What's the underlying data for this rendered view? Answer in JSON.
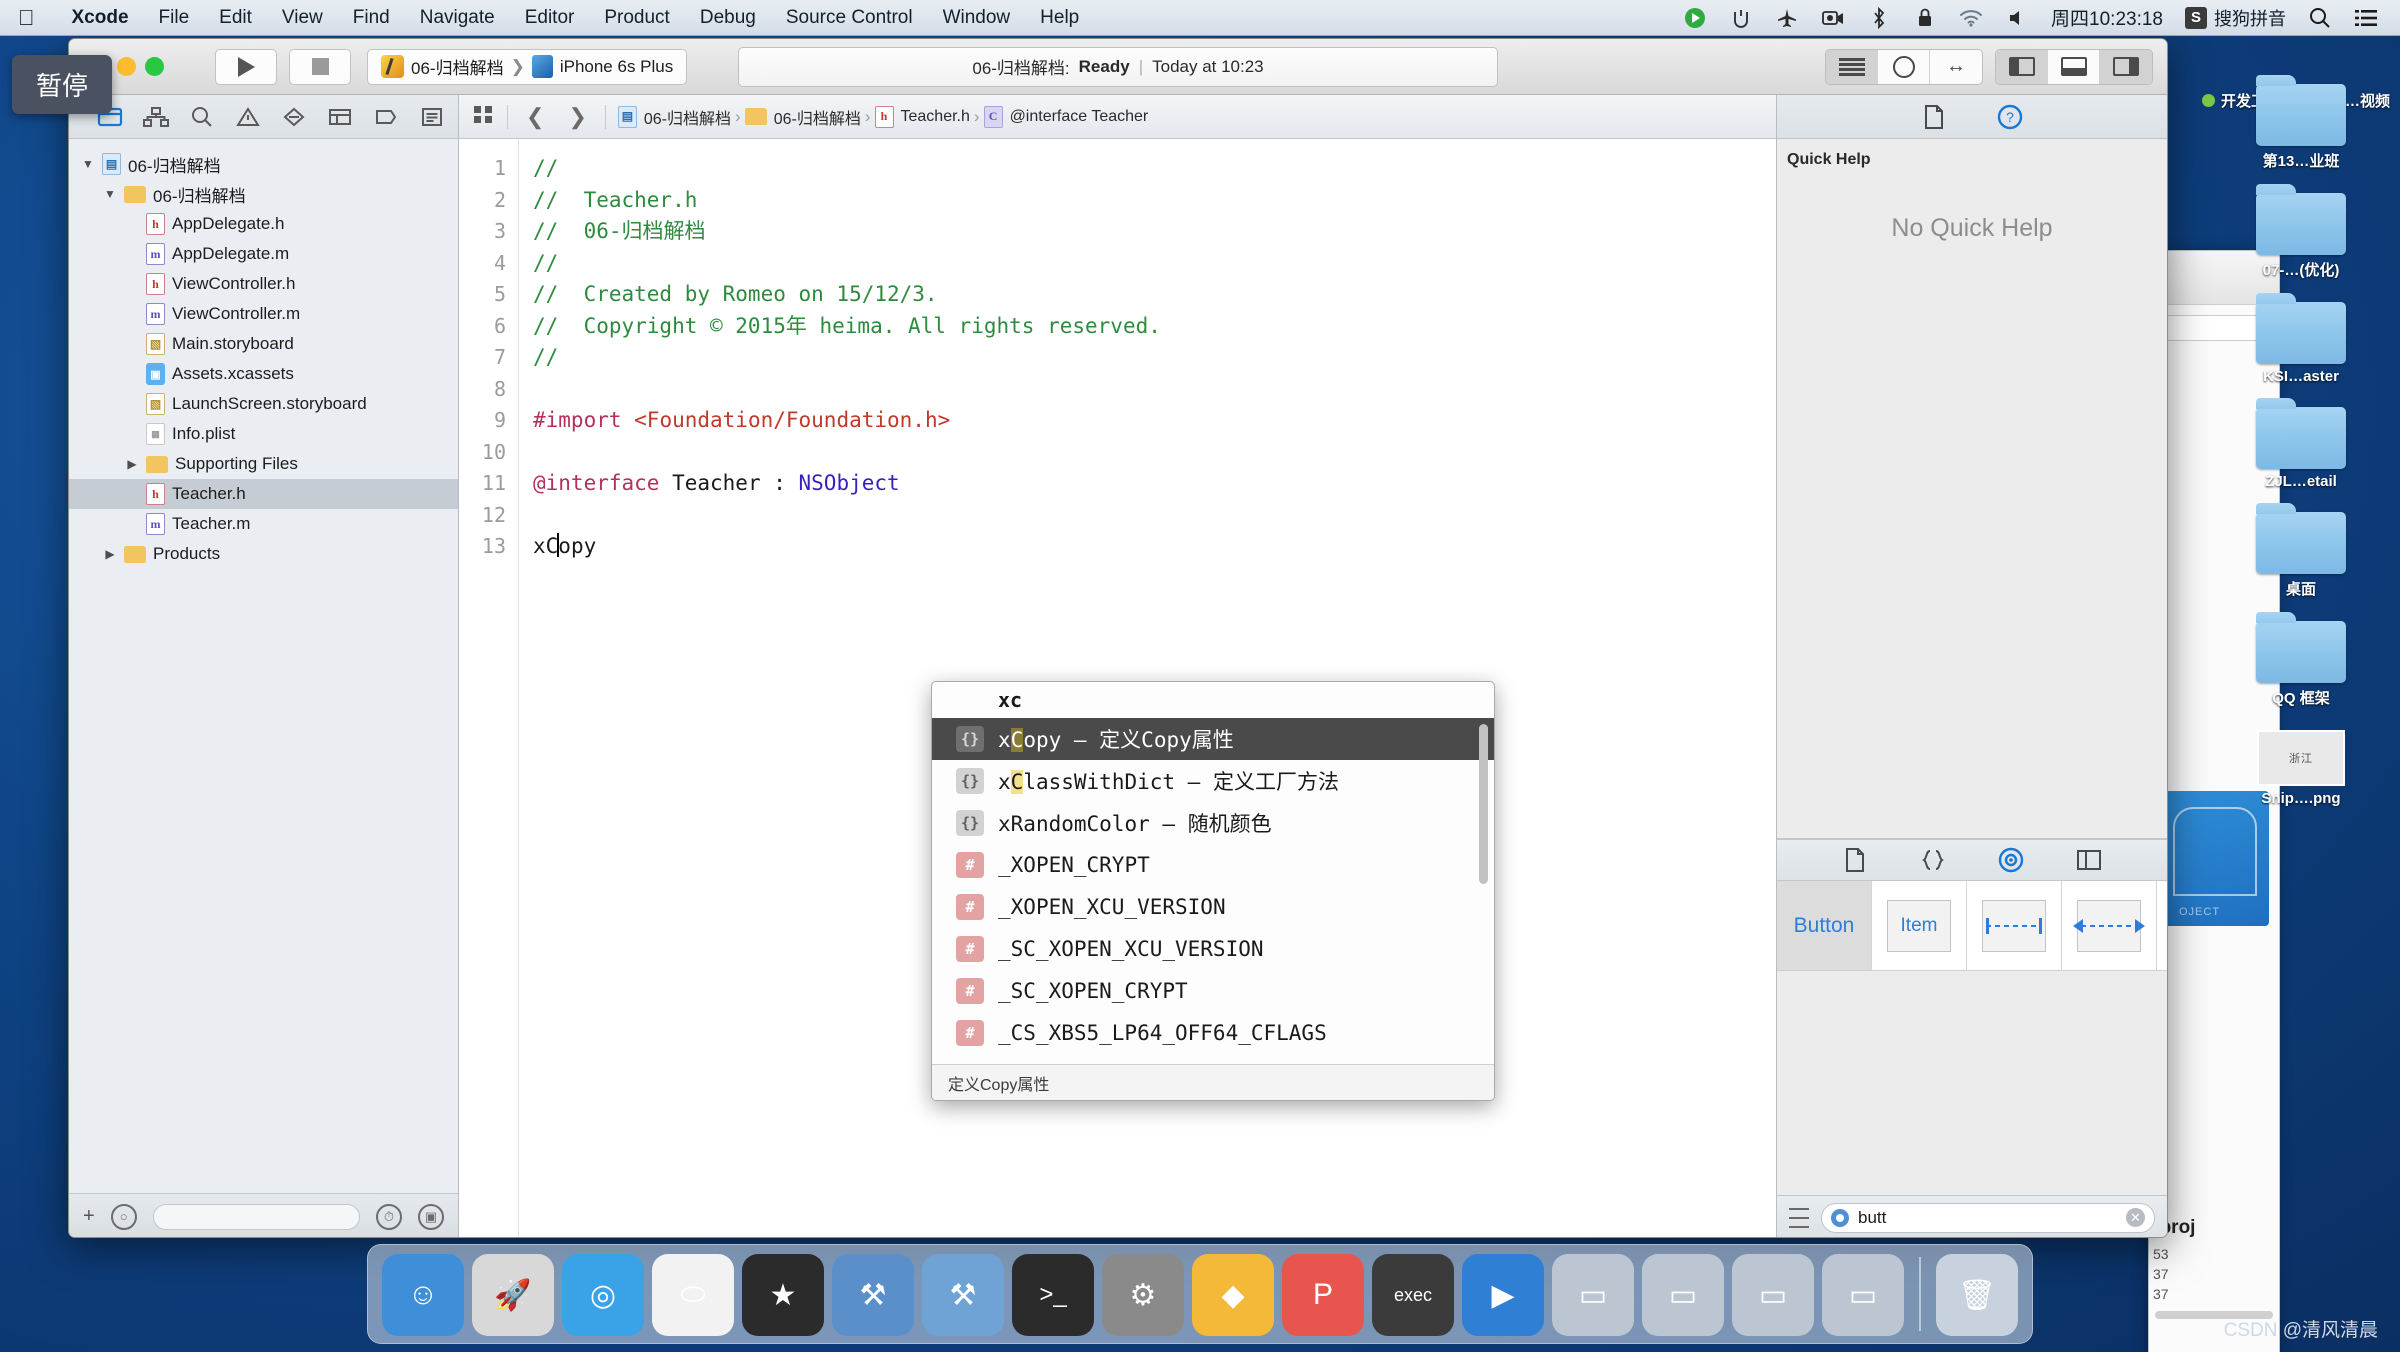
{
  "menubar": {
    "apple_icon": "apple-icon",
    "items": [
      {
        "label": "Xcode",
        "bold": true
      },
      {
        "label": "File",
        "bold": false
      },
      {
        "label": "Edit",
        "bold": false
      },
      {
        "label": "View",
        "bold": false
      },
      {
        "label": "Find",
        "bold": false
      },
      {
        "label": "Navigate",
        "bold": false
      },
      {
        "label": "Editor",
        "bold": false
      },
      {
        "label": "Product",
        "bold": false
      },
      {
        "label": "Debug",
        "bold": false
      },
      {
        "label": "Source Control",
        "bold": false
      },
      {
        "label": "Window",
        "bold": false
      },
      {
        "label": "Help",
        "bold": false
      }
    ],
    "status_icons": [
      "play-circle-icon",
      "eject-icon",
      "airplane-icon",
      "screen-record-icon",
      "bluetooth-icon",
      "lock-icon",
      "wifi-icon",
      "volume-icon"
    ],
    "clock": "周四10:23:18",
    "ime_badge": "S",
    "ime_label": "搜狗拼音",
    "search_icon": "search-icon",
    "list_icon": "notification-center-icon"
  },
  "tooltip": {
    "text": "暂停"
  },
  "toolbar": {
    "run_icon": "play-icon",
    "stop_icon": "stop-icon",
    "scheme_project": "06-归档解档",
    "scheme_device": "iPhone 6s Plus",
    "status": {
      "project": "06-归档解档:",
      "state": "Ready",
      "separator": "|",
      "time": "Today at 10:23"
    },
    "editor_segment": [
      "standard-editor-icon",
      "assistant-editor-icon",
      "version-editor-icon"
    ],
    "pane_segment": [
      "toggle-navigator-icon",
      "toggle-debug-area-icon",
      "toggle-utilities-icon"
    ]
  },
  "navigator": {
    "tabs": [
      "project-navigator-icon",
      "symbol-navigator-icon",
      "find-navigator-icon",
      "issue-navigator-icon",
      "test-navigator-icon",
      "debug-navigator-icon",
      "breakpoint-navigator-icon",
      "report-navigator-icon"
    ],
    "tree": [
      {
        "label": "06-归档解档",
        "icon": "proj",
        "indent": 0,
        "twisty": "down",
        "selected": false
      },
      {
        "label": "06-归档解档",
        "icon": "folder",
        "indent": 1,
        "twisty": "down",
        "selected": false
      },
      {
        "label": "AppDelegate.h",
        "icon": "h",
        "indent": 2,
        "twisty": "blank",
        "selected": false
      },
      {
        "label": "AppDelegate.m",
        "icon": "m",
        "indent": 2,
        "twisty": "blank",
        "selected": false
      },
      {
        "label": "ViewController.h",
        "icon": "h",
        "indent": 2,
        "twisty": "blank",
        "selected": false
      },
      {
        "label": "ViewController.m",
        "icon": "m",
        "indent": 2,
        "twisty": "blank",
        "selected": false
      },
      {
        "label": "Main.storyboard",
        "icon": "sb",
        "indent": 2,
        "twisty": "blank",
        "selected": false
      },
      {
        "label": "Assets.xcassets",
        "icon": "xca",
        "indent": 2,
        "twisty": "blank",
        "selected": false
      },
      {
        "label": "LaunchScreen.storyboard",
        "icon": "sb",
        "indent": 2,
        "twisty": "blank",
        "selected": false
      },
      {
        "label": "Info.plist",
        "icon": "plist",
        "indent": 2,
        "twisty": "blank",
        "selected": false
      },
      {
        "label": "Supporting Files",
        "icon": "folder",
        "indent": 2,
        "twisty": "right",
        "selected": false
      },
      {
        "label": "Teacher.h",
        "icon": "h",
        "indent": 2,
        "twisty": "blank",
        "selected": true
      },
      {
        "label": "Teacher.m",
        "icon": "m",
        "indent": 2,
        "twisty": "blank",
        "selected": false
      },
      {
        "label": "Products",
        "icon": "folder",
        "indent": 1,
        "twisty": "right",
        "selected": false
      }
    ],
    "footer": {
      "add_icon": "add-icon",
      "filter_icon": "filter-icon",
      "recent_icon": "recent-files-icon",
      "source_control_icon": "source-control-filter-icon"
    }
  },
  "jumpbar": {
    "related_icon": "related-items-icon",
    "back_icon": "back-chevron-icon",
    "forward_icon": "forward-chevron-icon",
    "crumbs": [
      {
        "label": "06-归档解档",
        "icon": "proj"
      },
      {
        "label": "06-归档解档",
        "icon": "folder"
      },
      {
        "label": "Teacher.h",
        "icon": "h"
      },
      {
        "label": "@interface Teacher",
        "icon": "iface"
      }
    ]
  },
  "editor": {
    "line_numbers": [
      "1",
      "2",
      "3",
      "4",
      "5",
      "6",
      "7",
      "8",
      "9",
      "10",
      "11",
      "12",
      "13"
    ],
    "lines": [
      {
        "n": 1,
        "segs": [
          {
            "t": "//",
            "c": "c-com"
          }
        ]
      },
      {
        "n": 2,
        "segs": [
          {
            "t": "//  Teacher.h",
            "c": "c-com"
          }
        ]
      },
      {
        "n": 3,
        "segs": [
          {
            "t": "//  06-归档解档",
            "c": "c-com"
          }
        ]
      },
      {
        "n": 4,
        "segs": [
          {
            "t": "//",
            "c": "c-com"
          }
        ]
      },
      {
        "n": 5,
        "segs": [
          {
            "t": "//  Created by Romeo on 15/12/3.",
            "c": "c-com"
          }
        ]
      },
      {
        "n": 6,
        "segs": [
          {
            "t": "//  Copyright © 2015年 heima. All rights reserved.",
            "c": "c-com"
          }
        ]
      },
      {
        "n": 7,
        "segs": [
          {
            "t": "//",
            "c": "c-com"
          }
        ]
      },
      {
        "n": 8,
        "segs": []
      },
      {
        "n": 9,
        "segs": [
          {
            "t": "#import ",
            "c": "c-pre"
          },
          {
            "t": "<Foundation/Foundation.h>",
            "c": "c-str"
          }
        ]
      },
      {
        "n": 10,
        "segs": []
      },
      {
        "n": 11,
        "segs": [
          {
            "t": "@interface",
            "c": "c-kw"
          },
          {
            "t": " Teacher : ",
            "c": ""
          },
          {
            "t": "NSObject",
            "c": "c-cls"
          }
        ]
      },
      {
        "n": 12,
        "segs": []
      },
      {
        "n": 13,
        "segs": [
          {
            "t": "xC",
            "c": ""
          },
          {
            "t": "__CARET__",
            "c": "caret"
          },
          {
            "t": "opy",
            "c": ""
          }
        ]
      }
    ]
  },
  "autocomplete": {
    "header": "xc",
    "rows": [
      {
        "icon": "brace",
        "pre": "x",
        "hl": "C",
        "post": "opy",
        "desc": " – 定义Copy属性",
        "selected": true
      },
      {
        "icon": "brace",
        "pre": "x",
        "hl": "C",
        "post": "lassWithDict",
        "desc": " – 定义工厂方法",
        "selected": false
      },
      {
        "icon": "brace",
        "pre": "x",
        "hl": "",
        "post": "RandomColor",
        "desc": " – 随机颜色",
        "selected": false
      },
      {
        "icon": "hash",
        "pre": "_X",
        "hl": "",
        "post": "OPEN_CRYPT",
        "desc": "",
        "selected": false
      },
      {
        "icon": "hash",
        "pre": "_X",
        "hl": "",
        "post": "OPEN_XCU_VERSION",
        "desc": "",
        "selected": false
      },
      {
        "icon": "hash",
        "pre": "_SC_X",
        "hl": "",
        "post": "OPEN_XCU_VERSION",
        "desc": "",
        "selected": false
      },
      {
        "icon": "hash",
        "pre": "_SC_X",
        "hl": "",
        "post": "OPEN_CRYPT",
        "desc": "",
        "selected": false
      },
      {
        "icon": "hash",
        "pre": "_CS_X",
        "hl": "",
        "post": "BS5_LP64_OFF64_CFLAGS",
        "desc": "",
        "selected": false
      }
    ],
    "footer": "定义Copy属性"
  },
  "utilities": {
    "tabs": [
      "file-inspector-icon",
      "quick-help-inspector-icon"
    ],
    "quick_help": {
      "title": "Quick Help",
      "empty_message": "No Quick Help"
    },
    "library": {
      "tabs": [
        "file-template-library-icon",
        "code-snippet-library-icon",
        "object-library-icon",
        "media-library-icon"
      ],
      "items": [
        {
          "label": "Button",
          "kind": "text",
          "selected": true
        },
        {
          "label": "Item",
          "kind": "text",
          "selected": false
        },
        {
          "label": "",
          "kind": "fixed-space",
          "selected": false
        },
        {
          "label": "",
          "kind": "flexible-space",
          "selected": false
        }
      ],
      "search_value": "butt",
      "search_icon": "search-icon",
      "clear_icon": "clear-icon",
      "layout_icon": "list-layout-icon"
    }
  },
  "desktop": {
    "top_items": [
      {
        "label": "开发工具",
        "dot": "#7ac943"
      },
      {
        "label": "未…视频",
        "dot": "#d93025"
      }
    ],
    "icons": [
      {
        "label": "第13…业班",
        "kind": "folder"
      },
      {
        "label": "07-…(优化)",
        "kind": "folder"
      },
      {
        "label": "KSI…aster",
        "kind": "folder"
      },
      {
        "label": "ZJL…etail",
        "kind": "folder"
      },
      {
        "label": "桌面",
        "kind": "folder"
      },
      {
        "label": "QQ 框架",
        "kind": "folder"
      },
      {
        "label": "Snip….png",
        "kind": "image"
      }
    ],
    "finder_background": {
      "filename": "eproj",
      "times": [
        "53",
        "37",
        "37"
      ]
    }
  },
  "dock": {
    "apps": [
      {
        "name": "finder",
        "color": "#3f8fd8",
        "glyph": "☺"
      },
      {
        "name": "launchpad",
        "color": "#d8d8d8",
        "glyph": "🚀"
      },
      {
        "name": "safari",
        "color": "#3aa3e8",
        "glyph": "◎"
      },
      {
        "name": "mouse-app",
        "color": "#f2f2f2",
        "glyph": "⬭"
      },
      {
        "name": "imovie",
        "color": "#2b2b2b",
        "glyph": "★"
      },
      {
        "name": "xcode",
        "color": "#5b8fc9",
        "glyph": "⚒"
      },
      {
        "name": "xcode-beta",
        "color": "#6fa3d6",
        "glyph": "⚒"
      },
      {
        "name": "terminal",
        "color": "#2b2b2b",
        "glyph": ">_"
      },
      {
        "name": "system-preferences",
        "color": "#8a8a8a",
        "glyph": "⚙"
      },
      {
        "name": "sketch",
        "color": "#f5b93a",
        "glyph": "◆"
      },
      {
        "name": "paw",
        "color": "#e8554e",
        "glyph": "P"
      },
      {
        "name": "executable",
        "color": "#3b3b3b",
        "glyph": "exec"
      },
      {
        "name": "media-player",
        "color": "#2f7fd4",
        "glyph": "▶"
      },
      {
        "name": "display-1",
        "color": "#bcc6d2",
        "glyph": "▭"
      },
      {
        "name": "display-2",
        "color": "#bcc6d2",
        "glyph": "▭"
      },
      {
        "name": "display-3",
        "color": "#bcc6d2",
        "glyph": "▭"
      },
      {
        "name": "display-4",
        "color": "#bcc6d2",
        "glyph": "▭"
      },
      {
        "name": "trash",
        "color": "#c8d2de",
        "glyph": "🗑"
      }
    ]
  },
  "watermark": {
    "text": "CSDN @清风清晨"
  }
}
